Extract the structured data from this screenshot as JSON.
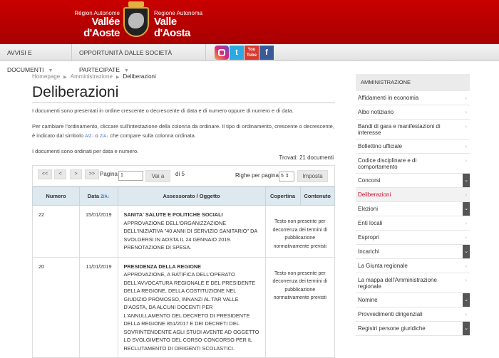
{
  "header": {
    "left_small": "Région Autonome",
    "left_big": "Vallée d'Aoste",
    "right_small": "Regione Autonoma",
    "right_big": "Valle d'Aosta"
  },
  "nav": {
    "items": [
      {
        "label": "AVVISI E DOCUMENTI"
      },
      {
        "label": "OPPORTUNITÀ DALLE SOCIETÀ PARTECIPATE"
      }
    ],
    "social": [
      "instagram-icon",
      "twitter-icon",
      "youtube-icon",
      "facebook-icon"
    ],
    "social_labels": {
      "twitter": "t",
      "youtube": "You Tube",
      "facebook": "f"
    }
  },
  "breadcrumb": [
    "Homepage",
    "Amministrazione",
    "Deliberazioni"
  ],
  "page": {
    "title": "Deliberazioni",
    "intro": "I documenti sono presentati in ordine crescente o decrescente di data e di numero oppure di numero e di data.",
    "sort_a": "Per cambiare l'ordinamento, cliccare sull'intestazione della colonna da ordinare. Il tipo di ordinamento, crescente o decrescente, è indicato dal simbolo",
    "sort_sym1": "A/Z↓",
    "sort_or": "o",
    "sort_sym2": "Z/A↓",
    "sort_b": "che compare sulla colonna ordinata.",
    "order": "I documenti sono ordinati per data e numero.",
    "found": "Trovati: 21 documenti"
  },
  "pager": {
    "first": "<<",
    "prev": "<",
    "next": ">",
    "last": ">>",
    "page_label": "Pagina",
    "page_value": "1",
    "go": "Vai a",
    "of": "di 5",
    "rows_label": "Righe per pagina",
    "rows_value": "5 ⇕",
    "set": "Imposta"
  },
  "table": {
    "headers": [
      "Numero",
      "Data",
      "Assessorato / Oggetto",
      "Copertina",
      "Contenuto"
    ],
    "sort_icon": "Z/A↓",
    "rows": [
      {
        "numero": "22",
        "data": "15/01/2019",
        "assessorato": "SANITA' SALUTE E POLITICHE SOCIALI",
        "oggetto": "APPROVAZIONE DELL'ORGANIZZAZIONE DELL'INIZIATIVA \"40 ANNI DI SERVIZIO SANITARIO\" DA SVOLGERSI IN AOSTA IL 24 GENNAIO 2019. PRENOTAZIONE DI SPESA.",
        "note": "Testo non presente per decorrenza dei termini di pubblicazione normativamente previsti"
      },
      {
        "numero": "20",
        "data": "11/01/2019",
        "assessorato": "PRESIDENZA DELLA REGIONE",
        "oggetto": "APPROVAZIONE, A RATIFICA DELL'OPERATO DELL'AVVOCATURA REGIONALE E DEL PRESIDENTE DELLA REGIONE, DELLA COSTITUZIONE NEL GIUDIZIO PROMOSSO, INNANZI AL TAR VALLE D'AOSTA, DA ALCUNI DOCENTI PER L'ANNULLAMENTO DEL DECRETO DI PRESIDENTE DELLA REGIONE 851/2017 E DEI DECRETI DEL SOVRINTENDENTE AGLI STUDI AVENTE AD OGGETTO LO SVOLGIMENTO DEL CORSO-CONCORSO PER IL RECLUTAMENTO DI DIRIGENTI SCOLASTICI.",
        "note": "Testo non presente per decorrenza dei termini di pubblicazione normativamente previsti"
      }
    ]
  },
  "sidebar": {
    "title": "AMMINISTRAZIONE",
    "items": [
      {
        "label": "Affidamenti in economia",
        "type": "arrow"
      },
      {
        "label": "Albo notiziario",
        "type": "arrow"
      },
      {
        "label": "Bandi di gara e manifestazioni di interesse",
        "type": "arrow"
      },
      {
        "label": "Bollettino ufficiale",
        "type": "arrow"
      },
      {
        "label": "Codice disciplinare e di comportamento",
        "type": "arrow"
      },
      {
        "label": "Concorsi",
        "type": "drop"
      },
      {
        "label": "Deliberazioni",
        "type": "arrow",
        "active": true
      },
      {
        "label": "Elezioni",
        "type": "drop"
      },
      {
        "label": "Enti locali",
        "type": "arrow"
      },
      {
        "label": "Espropri",
        "type": "arrow"
      },
      {
        "label": "Incarichi",
        "type": "drop"
      },
      {
        "label": "La Giunta regionale",
        "type": "arrow"
      },
      {
        "label": "La mappa dell'Amministrazione regionale",
        "type": "arrow"
      },
      {
        "label": "Nomine",
        "type": "drop"
      },
      {
        "label": "Provvedimenti dirigenziali",
        "type": "arrow"
      },
      {
        "label": "Registri persone giuridiche",
        "type": "drop"
      }
    ]
  }
}
